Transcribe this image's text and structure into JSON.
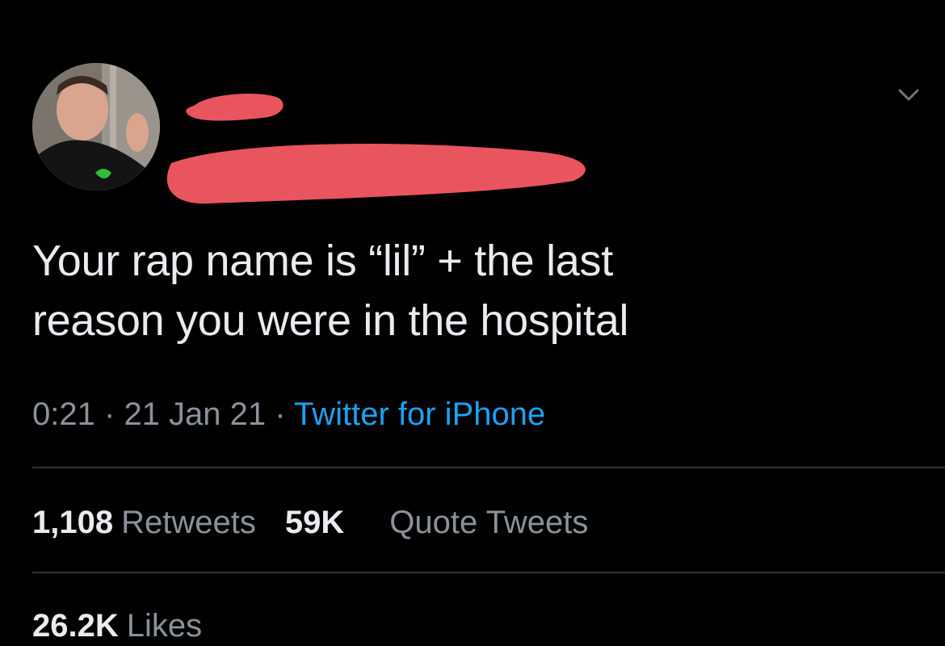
{
  "tweet": {
    "text": "Your rap name is “lil” + the last\nreason you were in the hospital",
    "time": "0:21",
    "separator": "·",
    "date": "21 Jan 21",
    "source": "Twitter for iPhone"
  },
  "stats": {
    "retweets_count": "1,108",
    "retweets_label": "Retweets",
    "quotes_count": "59K",
    "quotes_label": "Quote Tweets",
    "likes_count": "26.2K",
    "likes_label": "Likes"
  },
  "icons": {
    "menu": "chevron-down-icon",
    "avatar": "avatar"
  },
  "colors": {
    "background": "#000000",
    "text": "#e9ebed",
    "secondary": "#8a9199",
    "link": "#1da1f2",
    "redaction": "#e8555f"
  }
}
